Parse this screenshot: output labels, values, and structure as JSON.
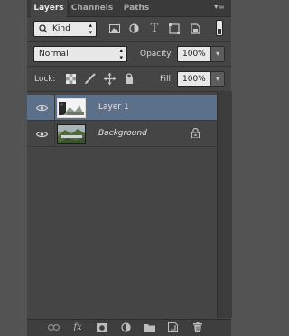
{
  "tabs": [
    {
      "label": "Layers",
      "active": true
    },
    {
      "label": "Channels",
      "active": false
    },
    {
      "label": "Paths",
      "active": false
    }
  ],
  "filter": {
    "kind_label": "Kind",
    "icons": [
      "image-filter-icon",
      "adjustment-filter-icon",
      "type-filter-icon",
      "shape-filter-icon",
      "smart-object-filter-icon"
    ]
  },
  "blend": {
    "mode": "Normal",
    "opacity_label": "Opacity:",
    "opacity_value": "100%"
  },
  "lock": {
    "label": "Lock:",
    "fill_label": "Fill:",
    "fill_value": "100%"
  },
  "layers": [
    {
      "name": "Layer 1",
      "selected": true,
      "visible": true,
      "italic": false,
      "locked": false
    },
    {
      "name": "Background",
      "selected": false,
      "visible": true,
      "italic": true,
      "locked": true
    }
  ],
  "footer_icons": [
    "link-layers-icon",
    "fx-icon",
    "add-mask-icon",
    "adjustment-layer-icon",
    "new-group-icon",
    "new-layer-icon",
    "delete-icon"
  ],
  "colors": {
    "panel": "#454545",
    "selection": "#5d708a",
    "field": "#e8e8e8"
  }
}
